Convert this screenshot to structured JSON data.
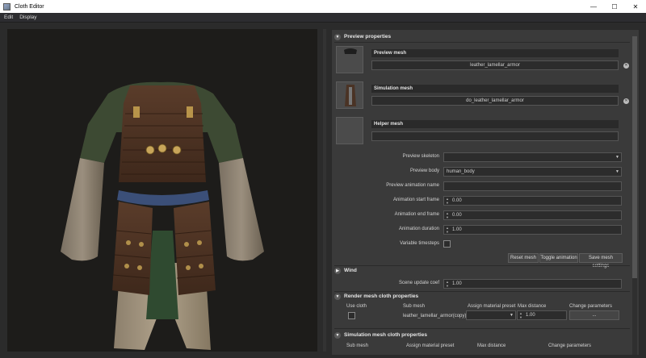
{
  "window": {
    "title": "Cloth Editor",
    "minimize": "—",
    "maximize": "☐",
    "close": "✕"
  },
  "menu": {
    "items": [
      "Edit",
      "Display"
    ]
  },
  "preview": {
    "title": "Preview properties",
    "preview_mesh": {
      "label": "Preview mesh",
      "value": "leather_lamellar_armor"
    },
    "simulation_mesh": {
      "label": "Simulation mesh",
      "value": "do_leather_lamellar_armor"
    },
    "helper_mesh": {
      "label": "Helper mesh",
      "value": ""
    },
    "preview_skeleton": {
      "label": "Preview skeleton",
      "value": ""
    },
    "preview_body": {
      "label": "Preview body",
      "value": "human_body"
    },
    "preview_animation_name": {
      "label": "Preview animation name",
      "value": ""
    },
    "animation_start_frame": {
      "label": "Animation start frame",
      "value": "0.00"
    },
    "animation_end_frame": {
      "label": "Animation end frame",
      "value": "0.00"
    },
    "animation_duration": {
      "label": "Animation duration",
      "value": "1.00"
    },
    "variable_timesteps": {
      "label": "Variable timesteps",
      "checked": false
    },
    "buttons": {
      "reset": "Reset mesh",
      "toggle": "Toggle animation",
      "save": "Save mesh settings"
    }
  },
  "wind": {
    "title": "Wind",
    "scene_update_coef": {
      "label": "Scene update coef",
      "value": "1.00"
    }
  },
  "render_cloth": {
    "title": "Render mesh cloth properties",
    "headers": [
      "Use cloth",
      "Sub mesh",
      "Assign material preset",
      "Max distance",
      "Change parameters"
    ],
    "row": {
      "sub_mesh": "leather_lamellar_armor(copy)",
      "preset": "",
      "max_distance": "1.00",
      "change": "..."
    }
  },
  "sim_cloth": {
    "title": "Simulation mesh cloth properties",
    "headers": [
      "Sub mesh",
      "Assign material preset",
      "Max distance",
      "Change parameters"
    ]
  },
  "icons": {
    "clear": "clear-icon",
    "spin": "spinner-icon",
    "dropdown": "chevron-down-icon",
    "collapse": "collapse-arrow-icon"
  }
}
